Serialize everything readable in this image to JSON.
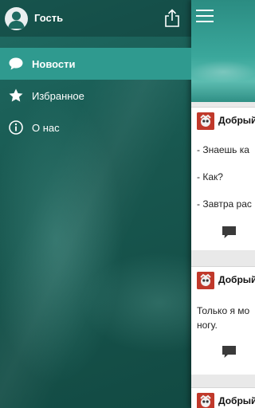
{
  "drawer": {
    "user_name": "Гость",
    "menu": [
      {
        "label": "Новости",
        "icon": "chat-bubble-icon",
        "active": true
      },
      {
        "label": "Избранное",
        "icon": "star-icon",
        "active": false
      },
      {
        "label": "О нас",
        "icon": "info-icon",
        "active": false
      }
    ]
  },
  "feed": {
    "posts": [
      {
        "author": "Добрый",
        "lines": [
          "- Знаешь ка",
          "- Как?",
          "- Завтра рас"
        ]
      },
      {
        "author": "Добрый",
        "lines": [
          "Только я мо",
          "ногу."
        ]
      },
      {
        "author": "Добрый",
        "lines": []
      }
    ]
  },
  "colors": {
    "accent": "#2f9a8f",
    "drawer_bg": "#1d5f57",
    "avatar_red": "#c0392b"
  }
}
